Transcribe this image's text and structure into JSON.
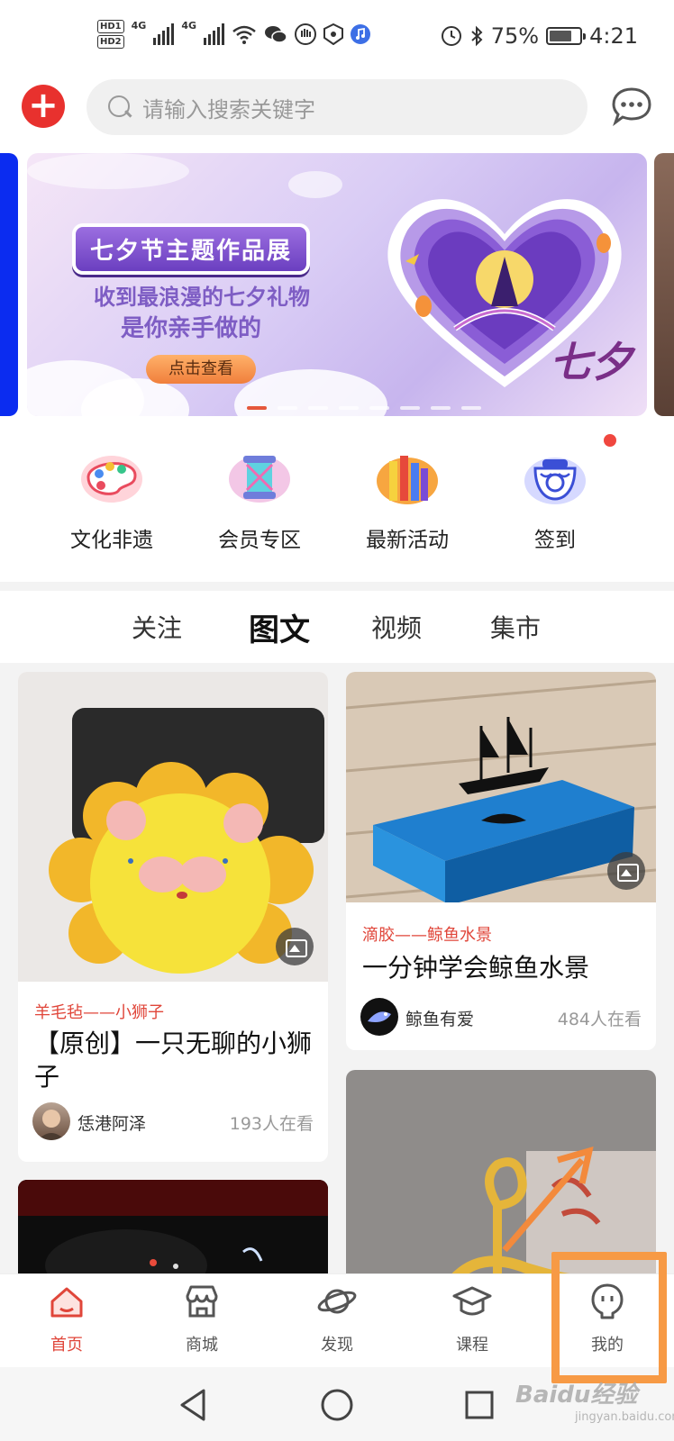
{
  "status_bar": {
    "network_badges": [
      "HD1",
      "HD2"
    ],
    "signal_labels": [
      "4G",
      "4G"
    ],
    "battery_percent": "75%",
    "time": "4:21",
    "icons": [
      "wifi-icon",
      "wechat-icon",
      "hand-icon",
      "shield-icon",
      "music-icon",
      "alarm-icon",
      "bluetooth-icon",
      "battery-icon"
    ]
  },
  "header": {
    "add_icon": "plus-icon",
    "search_placeholder": "请输入搜索关键字",
    "message_icon": "chat-bubble-icon"
  },
  "banner": {
    "title": "七夕节主题作品展",
    "line1": "收到最浪漫的七夕礼物",
    "line2": "是你亲手做的",
    "cta": "点击查看",
    "logo_text": "七夕",
    "page_count": 8,
    "active_page": 1
  },
  "quick_entries": [
    {
      "label": "文化非遗",
      "icon": "palette-icon"
    },
    {
      "label": "会员专区",
      "icon": "spool-icon"
    },
    {
      "label": "最新活动",
      "icon": "pencils-icon"
    },
    {
      "label": "签到",
      "icon": "porcelain-bowl-icon",
      "has_badge": true
    }
  ],
  "feed_tabs": [
    {
      "label": "关注",
      "active": false
    },
    {
      "label": "图文",
      "active": true
    },
    {
      "label": "视频",
      "active": false
    },
    {
      "label": "集市",
      "active": false
    }
  ],
  "feed": {
    "cards": [
      {
        "tag": "羊毛毡——小狮子",
        "title": "【原创】一只无聊的小狮子",
        "author": "恁港阿泽",
        "views": "193人在看"
      },
      {
        "tag": "滴胶——鲸鱼水景",
        "title": "一分钟学会鲸鱼水景",
        "author": "鲸鱼有爱",
        "views": "484人在看"
      }
    ]
  },
  "bottom_nav": [
    {
      "label": "首页",
      "icon": "home-icon",
      "active": true
    },
    {
      "label": "商城",
      "icon": "store-icon",
      "active": false
    },
    {
      "label": "发现",
      "icon": "planet-icon",
      "active": false
    },
    {
      "label": "课程",
      "icon": "graduation-cap-icon",
      "active": false
    },
    {
      "label": "我的",
      "icon": "profile-icon",
      "active": false
    }
  ],
  "system_nav": [
    "back-icon",
    "home-circle-icon",
    "recents-icon"
  ],
  "colors": {
    "accent": "#e0463a",
    "highlight": "#f79a45"
  },
  "watermark": {
    "text": "Baidu经验",
    "sub": "jingyan.baidu.com"
  }
}
